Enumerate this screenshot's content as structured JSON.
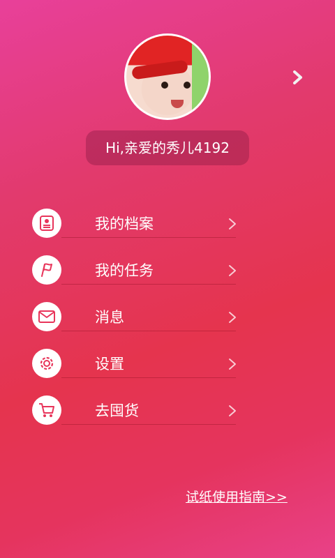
{
  "profile": {
    "greeting": "Hi,亲爱的秀儿4192"
  },
  "menu": {
    "items": [
      {
        "label": "我的档案",
        "icon": "profile-card-icon"
      },
      {
        "label": "我的任务",
        "icon": "flag-icon"
      },
      {
        "label": "消息",
        "icon": "envelope-icon"
      },
      {
        "label": "设置",
        "icon": "gear-icon"
      },
      {
        "label": "去囤货",
        "icon": "cart-icon"
      }
    ]
  },
  "footer": {
    "guide_link": "试纸使用指南>>"
  },
  "colors": {
    "accent": "#e8345a",
    "icon_pink": "#e8345a",
    "white": "#ffffff"
  }
}
